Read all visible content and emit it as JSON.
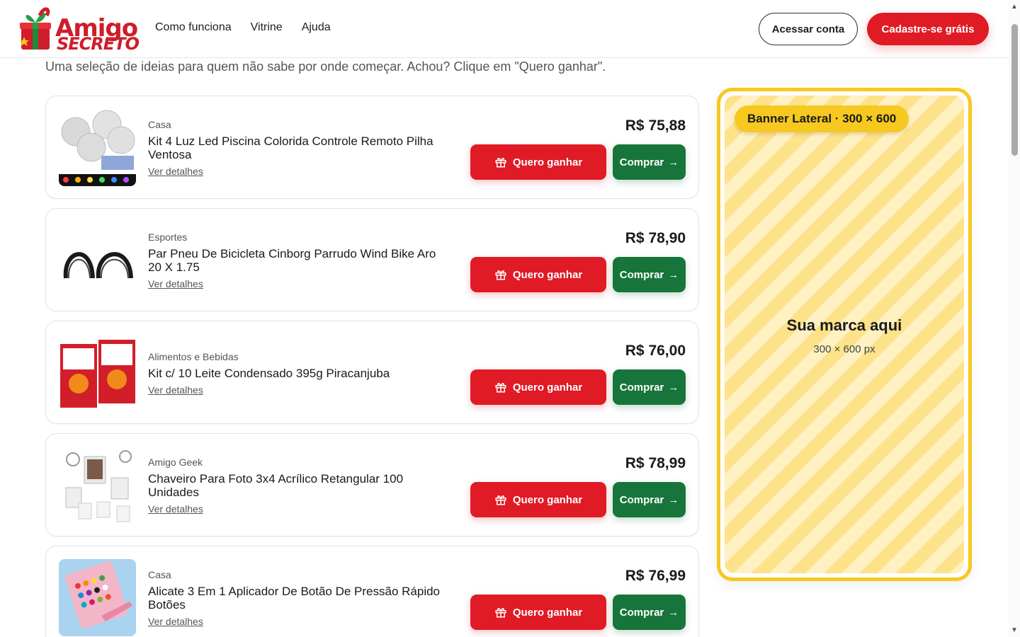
{
  "header": {
    "logo_line1": "Amigo",
    "logo_line2": "SECRETO",
    "nav": [
      "Como funciona",
      "Vitrine",
      "Ajuda"
    ],
    "login_label": "Acessar conta",
    "signup_label": "Cadastre-se grátis"
  },
  "subtitle": "Uma seleção de ideias para quem não sabe por onde começar. Achou? Clique em \"Quero ganhar\".",
  "products": [
    {
      "category": "Casa",
      "title": "Kit 4 Luz Led Piscina Colorida Controle Remoto Pilha Ventosa",
      "details": "Ver detalhes",
      "price": "R$ 75,88",
      "want_label": "Quero ganhar",
      "buy_label": "Comprar"
    },
    {
      "category": "Esportes",
      "title": "Par Pneu De Bicicleta Cinborg Parrudo Wind Bike Aro 20 X 1.75",
      "details": "Ver detalhes",
      "price": "R$ 78,90",
      "want_label": "Quero ganhar",
      "buy_label": "Comprar"
    },
    {
      "category": "Alimentos e Bebidas",
      "title": "Kit c/ 10 Leite Condensado 395g Piracanjuba",
      "details": "Ver detalhes",
      "price": "R$ 76,00",
      "want_label": "Quero ganhar",
      "buy_label": "Comprar"
    },
    {
      "category": "Amigo Geek",
      "title": "Chaveiro Para Foto 3x4 Acrílico Retangular 100 Unidades",
      "details": "Ver detalhes",
      "price": "R$ 78,99",
      "want_label": "Quero ganhar",
      "buy_label": "Comprar"
    },
    {
      "category": "Casa",
      "title": "Alicate 3 Em 1 Aplicador De Botão De Pressão Rápido Botões",
      "details": "Ver detalhes",
      "price": "R$ 76,99",
      "want_label": "Quero ganhar",
      "buy_label": "Comprar"
    }
  ],
  "banner": {
    "tag": "Banner Lateral · 300 × 600",
    "title": "Sua marca aqui",
    "size": "300 × 600 px"
  },
  "colors": {
    "brand_red": "#e01b25",
    "buy_green": "#17753b",
    "banner_yellow": "#f7c81f"
  }
}
